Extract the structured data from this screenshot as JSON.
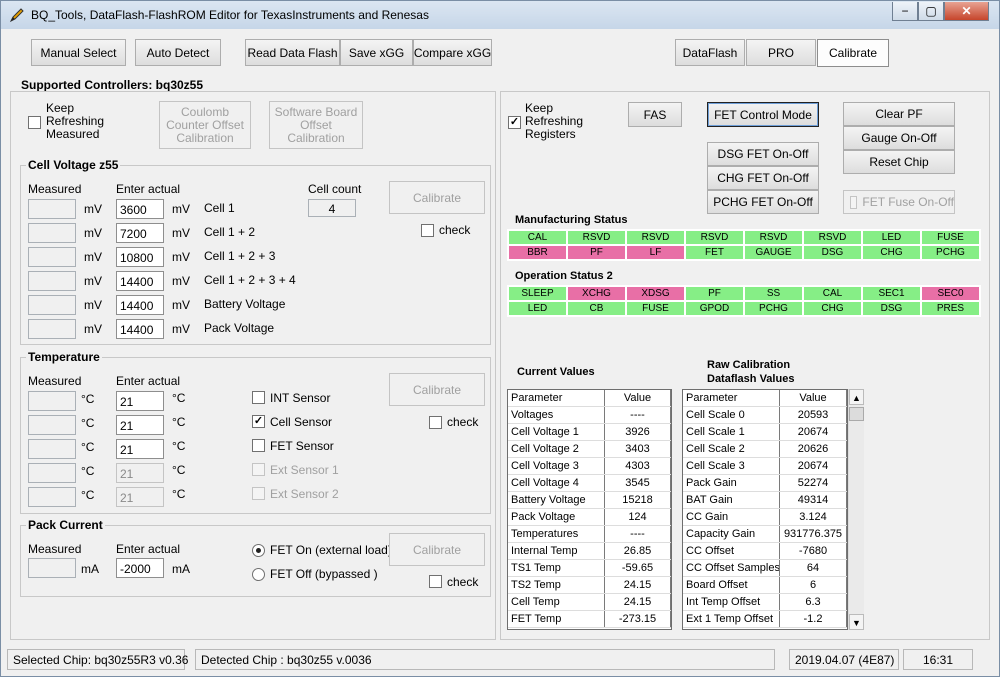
{
  "window": {
    "title": "BQ_Tools,   DataFlash-FlashROM Editor     for TexasInstruments and Renesas",
    "min": "−",
    "max": "▢",
    "close": "✕"
  },
  "toolbar": {
    "manual_select": "Manual Select",
    "auto_detect": "Auto Detect",
    "read_data_flash": "Read Data Flash",
    "save_xgg": "Save xGG",
    "compare_xgg": "Compare xGG",
    "tabs": [
      "DataFlash",
      "PRO",
      "Calibrate"
    ]
  },
  "supported": "Supported Controllers: bq30z55",
  "left": {
    "keep_refreshing": "Keep Refreshing Measured",
    "coulomb_counter": "Coulomb Counter Offset Calibration",
    "software_board": "Software Board Offset Calibration",
    "cell_voltage": {
      "title": "Cell Voltage z55",
      "measured_label": "Measured",
      "enter_actual_label": "Enter actual",
      "cell_count_label": "Cell count",
      "cell_count": "4",
      "calibrate": "Calibrate",
      "check": "check",
      "unit": "mV",
      "rows": [
        {
          "actual": "3600",
          "name": "Cell 1"
        },
        {
          "actual": "7200",
          "name": "Cell 1 + 2"
        },
        {
          "actual": "10800",
          "name": "Cell 1 + 2 + 3"
        },
        {
          "actual": "14400",
          "name": "Cell 1 + 2 + 3 + 4"
        },
        {
          "actual": "14400",
          "name": "Battery  Voltage"
        },
        {
          "actual": "14400",
          "name": "Pack    Voltage"
        }
      ]
    },
    "temperature": {
      "title": "Temperature",
      "measured_label": "Measured",
      "enter_actual_label": "Enter actual",
      "unit": "°C",
      "unit2": "°C",
      "calibrate": "Calibrate",
      "check": "check",
      "rows": [
        {
          "actual": "21",
          "sensor": "INT Sensor",
          "checked": false,
          "enabled": true
        },
        {
          "actual": "21",
          "sensor": "Cell Sensor",
          "checked": true,
          "enabled": true
        },
        {
          "actual": "21",
          "sensor": "FET Sensor",
          "checked": false,
          "enabled": true
        },
        {
          "actual": "21",
          "sensor": "Ext Sensor 1",
          "checked": false,
          "enabled": false
        },
        {
          "actual": "21",
          "sensor": "Ext Sensor 2",
          "checked": false,
          "enabled": false
        }
      ]
    },
    "pack_current": {
      "title": "Pack Current",
      "measured_label": "Measured",
      "enter_actual_label": "Enter actual",
      "unit": "mA",
      "actual": "-2000",
      "fet_on": "FET On (external load)",
      "fet_off": "FET Off (bypassed     )",
      "calibrate": "Calibrate",
      "check": "check"
    }
  },
  "right": {
    "keep_refreshing": "Keep Refreshing Registers",
    "fas": "FAS",
    "fet_control_mode": "FET Control Mode",
    "dsg": "DSG   FET  On-Off",
    "chg": "CHG   FET  On-Off",
    "pchg": "PCHG  FET  On-Off",
    "clear_pf": "Clear PF",
    "gauge_onoff": "Gauge On-Off",
    "reset_chip": "Reset Chip",
    "fet_fuse": "FET Fuse On-Off",
    "manufacturing_status_title": "Manufacturing Status",
    "manufacturing_status": [
      [
        "CAL",
        "g"
      ],
      [
        "RSVD",
        "g"
      ],
      [
        "RSVD",
        "g"
      ],
      [
        "RSVD",
        "g"
      ],
      [
        "RSVD",
        "g"
      ],
      [
        "RSVD",
        "g"
      ],
      [
        "LED",
        "g"
      ],
      [
        "FUSE",
        "g"
      ],
      [
        "BBR",
        "p"
      ],
      [
        "PF",
        "p"
      ],
      [
        "LF",
        "p"
      ],
      [
        "FET",
        "g"
      ],
      [
        "GAUGE",
        "g"
      ],
      [
        "DSG",
        "g"
      ],
      [
        "CHG",
        "g"
      ],
      [
        "PCHG",
        "g"
      ]
    ],
    "operation_status_title": "Operation Status 2",
    "operation_status": [
      [
        "SLEEP",
        "g"
      ],
      [
        "XCHG",
        "p"
      ],
      [
        "XDSG",
        "p"
      ],
      [
        "PF",
        "g"
      ],
      [
        "SS",
        "g"
      ],
      [
        "CAL",
        "g"
      ],
      [
        "SEC1",
        "g"
      ],
      [
        "SEC0",
        "p"
      ],
      [
        "LED",
        "g"
      ],
      [
        "CB",
        "g"
      ],
      [
        "FUSE",
        "g"
      ],
      [
        "GPOD",
        "g"
      ],
      [
        "PCHG",
        "g"
      ],
      [
        "CHG",
        "g"
      ],
      [
        "DSG",
        "g"
      ],
      [
        "PRES",
        "g"
      ]
    ],
    "current_values_title": "Current Values",
    "raw_title": "Raw    Calibration Dataflash  Values",
    "current_values": {
      "headers": [
        "Parameter",
        "Value"
      ],
      "rows": [
        [
          "Voltages",
          "----"
        ],
        [
          "Cell Voltage 1",
          "3926"
        ],
        [
          "Cell Voltage 2",
          "3403"
        ],
        [
          "Cell Voltage 3",
          "4303"
        ],
        [
          "Cell Voltage 4",
          "3545"
        ],
        [
          "Battery Voltage",
          "15218"
        ],
        [
          "Pack Voltage",
          "124"
        ],
        [
          "Temperatures",
          "----"
        ],
        [
          "Internal Temp",
          "26.85"
        ],
        [
          "TS1 Temp",
          "-59.65"
        ],
        [
          "TS2 Temp",
          "24.15"
        ],
        [
          "Cell Temp",
          "24.15"
        ],
        [
          "FET Temp",
          "-273.15"
        ]
      ]
    },
    "raw_values": {
      "headers": [
        "Parameter",
        "Value"
      ],
      "rows": [
        [
          "Cell Scale 0",
          "20593"
        ],
        [
          "Cell Scale 1",
          "20674"
        ],
        [
          "Cell Scale 2",
          "20626"
        ],
        [
          "Cell Scale 3",
          "20674"
        ],
        [
          "Pack Gain",
          "52274"
        ],
        [
          "BAT Gain",
          "49314"
        ],
        [
          "CC Gain",
          "3.124"
        ],
        [
          "Capacity Gain",
          "931776.375"
        ],
        [
          "CC Offset",
          "-7680"
        ],
        [
          "CC Offset Samples",
          "64"
        ],
        [
          "Board Offset",
          "6"
        ],
        [
          "Int Temp Offset",
          "6.3"
        ],
        [
          "Ext 1 Temp Offset",
          "-1.2"
        ]
      ]
    }
  },
  "statusbar": {
    "selected_chip": "Selected Chip:  bq30z55R3 v0.36",
    "detected_chip": "Detected Chip : bq30z55  v.0036",
    "date": "2019.04.07  (4E87)",
    "time": "16:31"
  }
}
